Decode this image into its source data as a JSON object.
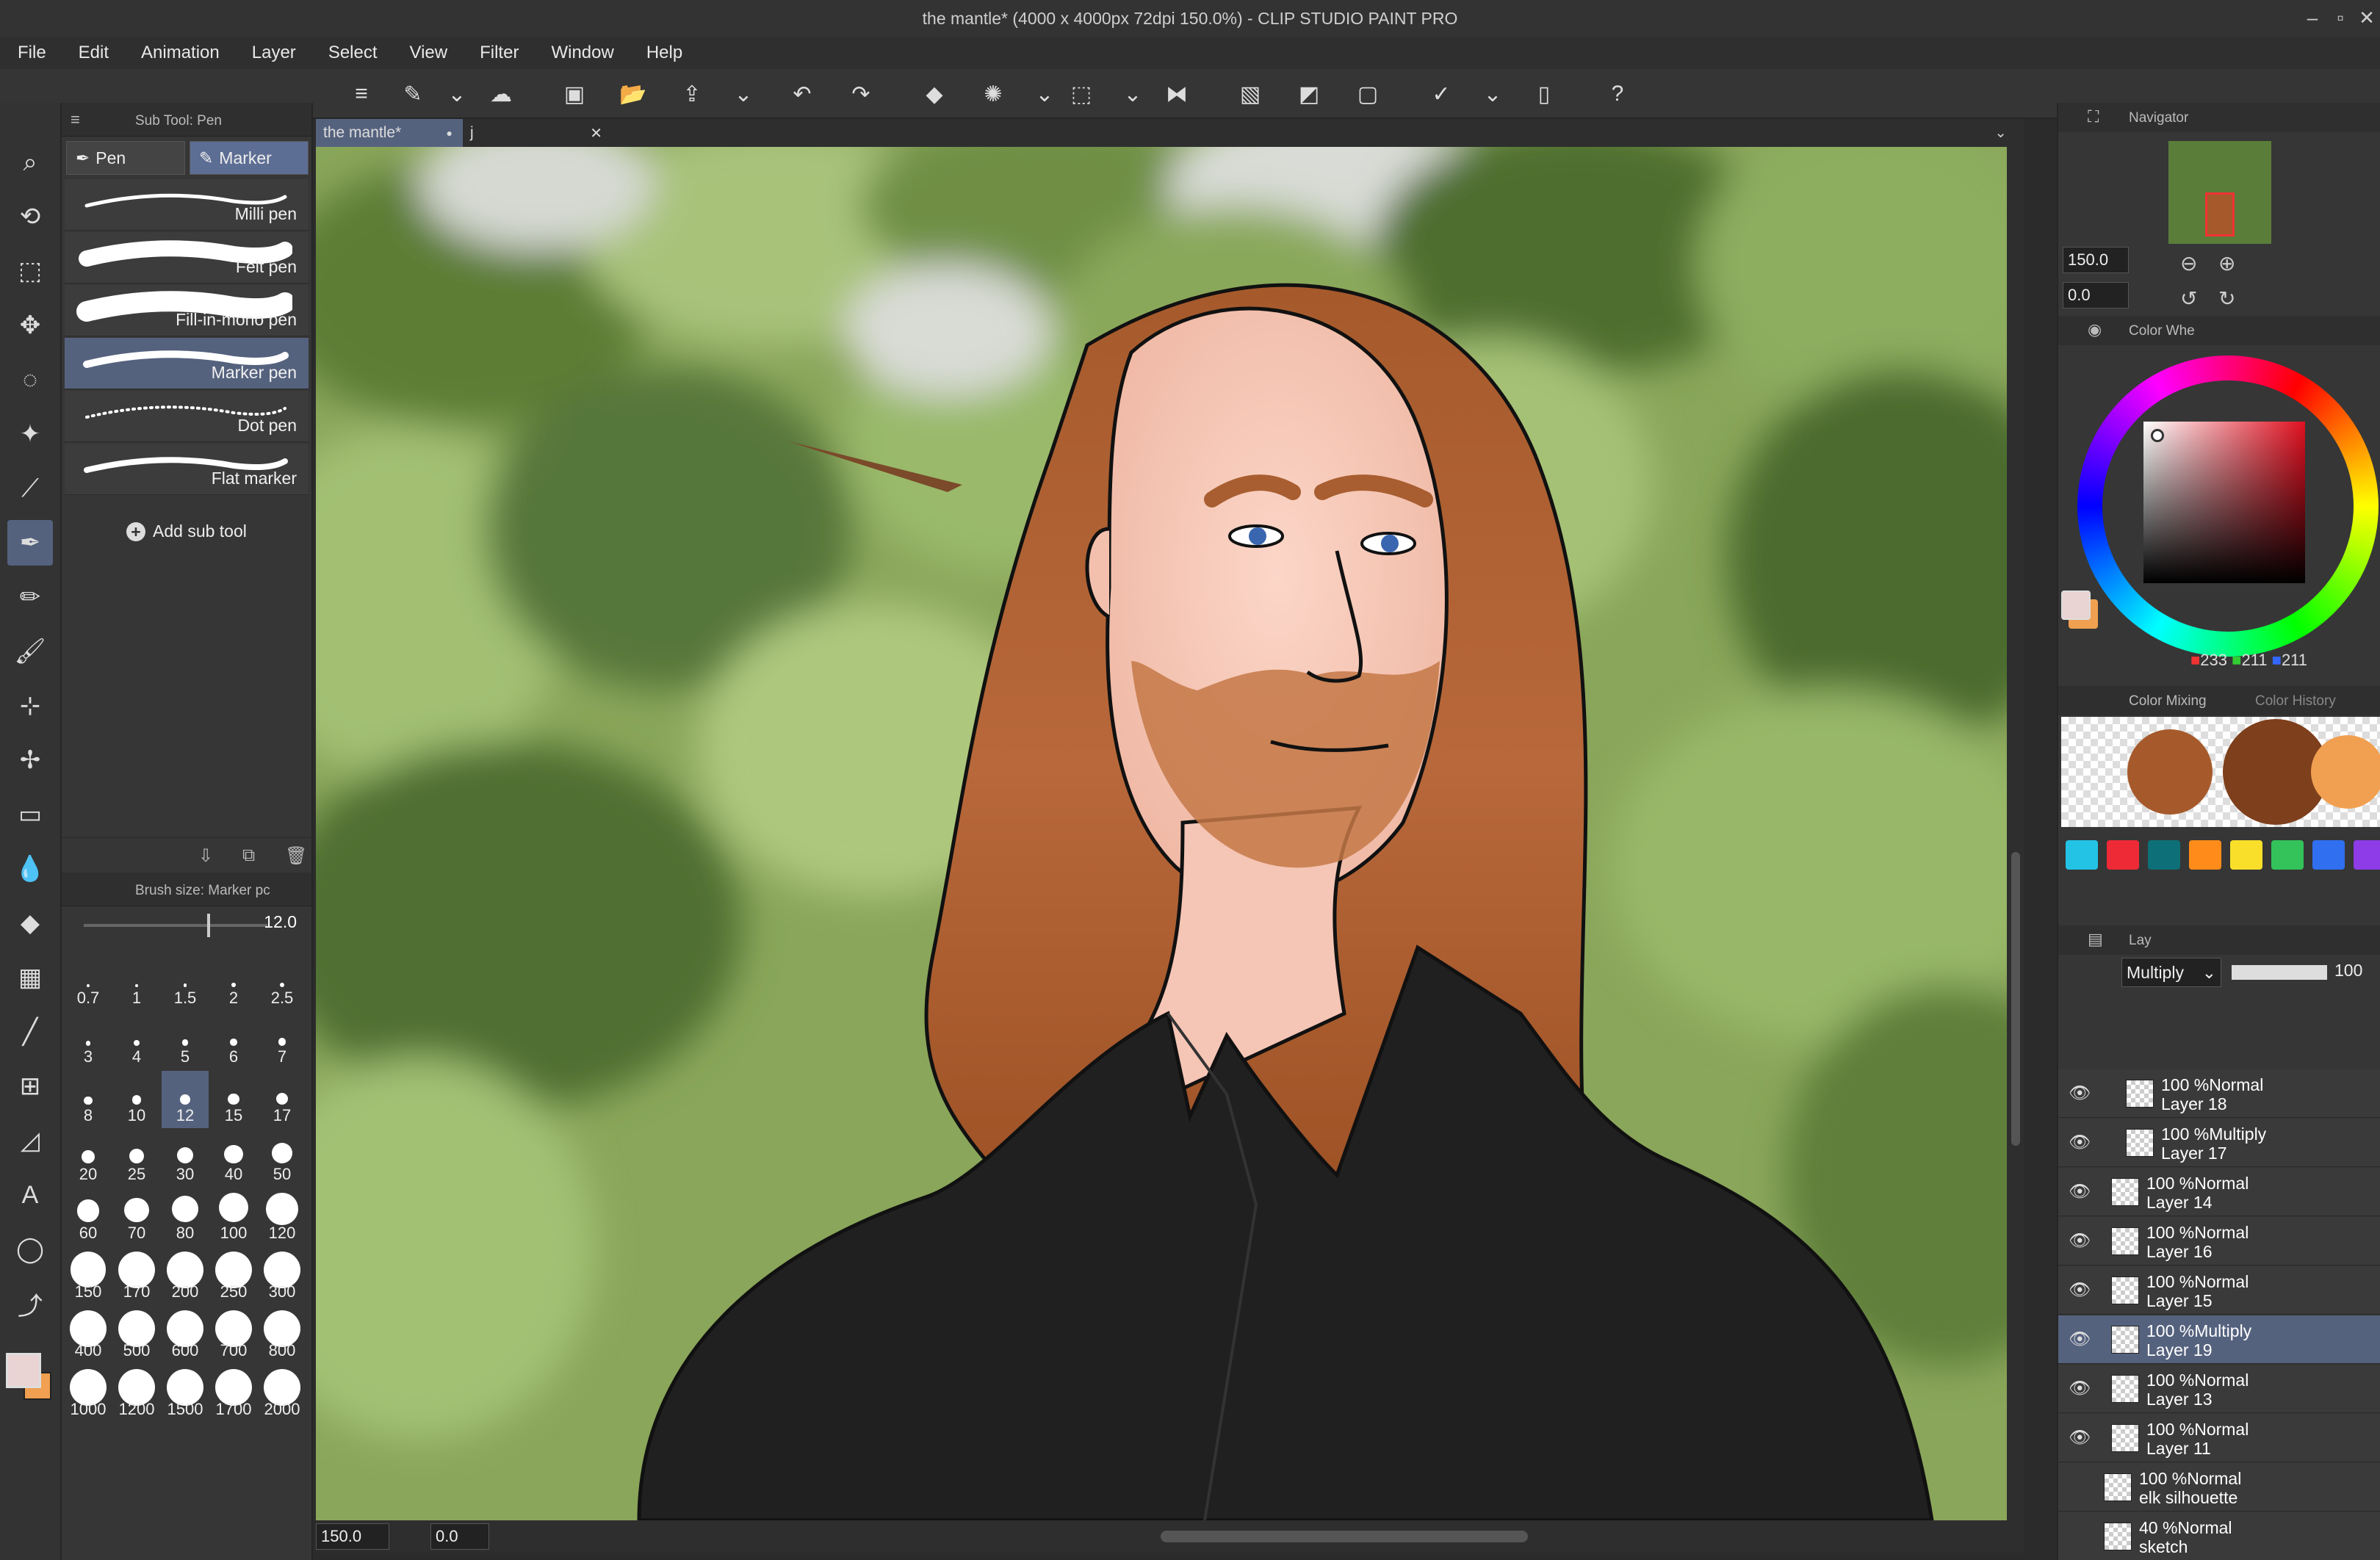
{
  "window": {
    "title": "the mantle* (4000 x 4000px 72dpi 150.0%) - CLIP STUDIO PAINT PRO"
  },
  "menu": [
    "File",
    "Edit",
    "Animation",
    "Layer",
    "Select",
    "View",
    "Filter",
    "Window",
    "Help"
  ],
  "command_bar": {
    "icons": [
      "menu-icon",
      "new-icon",
      "dropdown-icon",
      "cloud-icon",
      "new-canvas-icon",
      "open-icon",
      "save-icon",
      "dropdown-icon",
      "undo-icon",
      "redo-icon",
      "fill-icon",
      "loading-icon",
      "dropdown-icon",
      "transform-icon",
      "dropdown-icon",
      "flip-icon",
      "selection-icon",
      "gradient-icon",
      "crop-icon",
      "check-icon",
      "dropdown-icon",
      "tablet-icon",
      "help-icon"
    ]
  },
  "tools": [
    "zoom-icon",
    "rotate-icon",
    "object-icon",
    "move-icon",
    "lasso-icon",
    "magic-wand-icon",
    "eyedropper-icon",
    "pen-icon",
    "pencil-icon",
    "brush-icon",
    "airbrush-icon",
    "decoration-icon",
    "eraser-icon",
    "blend-icon",
    "fill-icon",
    "gradient-icon",
    "figure-icon",
    "frame-icon",
    "ruler-icon",
    "text-icon",
    "balloon-icon",
    "correct-line-icon"
  ],
  "subtool_panel": {
    "header": "Sub Tool: Pen",
    "tabs": [
      {
        "label": "Pen",
        "selected": false
      },
      {
        "label": "Marker",
        "selected": true
      }
    ],
    "brushes": [
      {
        "label": "Milli pen",
        "selected": false
      },
      {
        "label": "Felt pen",
        "selected": false
      },
      {
        "label": "Fill-in-mono pen",
        "selected": false
      },
      {
        "label": "Marker pen",
        "selected": true
      },
      {
        "label": "Dot pen",
        "selected": false
      },
      {
        "label": "Flat marker",
        "selected": false
      }
    ],
    "add_label": "Add sub tool"
  },
  "brush_size_panel": {
    "header": "Brush size: Marker pc",
    "value": "12.0",
    "sizes": [
      "0.7",
      "1",
      "1.5",
      "2",
      "2.5",
      "3",
      "4",
      "5",
      "6",
      "7",
      "8",
      "10",
      "12",
      "15",
      "17",
      "20",
      "25",
      "30",
      "40",
      "50",
      "60",
      "70",
      "80",
      "100",
      "120",
      "150",
      "170",
      "200",
      "250",
      "300",
      "400",
      "500",
      "600",
      "700",
      "800",
      "1000",
      "1200",
      "1500",
      "1700",
      "2000"
    ],
    "selected": "12"
  },
  "doc_tabs": [
    {
      "label": "the mantle*",
      "active": true
    },
    {
      "label": "j",
      "active": false
    }
  ],
  "status": {
    "zoom": "150.0",
    "angle": "0.0"
  },
  "navigator": {
    "title": "Navigator",
    "zoom": "150.0",
    "angle": "0.0"
  },
  "color_wheel": {
    "title": "Color Whe",
    "r": "233",
    "g": "211",
    "b": "211",
    "main_color": "#e9d3d3",
    "sub_color": "#f0a050"
  },
  "color_mixing": {
    "tab1": "Color Mixing",
    "tab2": "Color History",
    "blobs": [
      "#a65a2c",
      "#7e3f1c",
      "#f0a050"
    ],
    "palette": [
      "#23c3e6",
      "#ee2a36",
      "#0d6f77",
      "#ff8c1a",
      "#f9df2a",
      "#33c35a",
      "#2f6ff0",
      "#8d3ce8"
    ]
  },
  "layer_panel": {
    "title": "Lay",
    "blend_mode": "Multiply",
    "opacity": "100",
    "layers": [
      {
        "line1": "100 %Normal",
        "line2": "Layer 18",
        "selected": false
      },
      {
        "line1": "100 %Multiply",
        "line2": "Layer 17",
        "selected": false
      },
      {
        "line1": "100 %Normal",
        "line2": "Layer 14",
        "selected": false
      },
      {
        "line1": "100 %Normal",
        "line2": "Layer 16",
        "selected": false
      },
      {
        "line1": "100 %Normal",
        "line2": "Layer 15",
        "selected": false
      },
      {
        "line1": "100 %Multiply",
        "line2": "Layer 19",
        "selected": true
      },
      {
        "line1": "100 %Normal",
        "line2": "Layer 13",
        "selected": false
      },
      {
        "line1": "100 %Normal",
        "line2": "Layer 11",
        "selected": false
      },
      {
        "line1": "100 %Normal",
        "line2": "elk silhouette",
        "selected": false
      },
      {
        "line1": "40 %Normal",
        "line2": "sketch",
        "selected": false
      }
    ]
  }
}
